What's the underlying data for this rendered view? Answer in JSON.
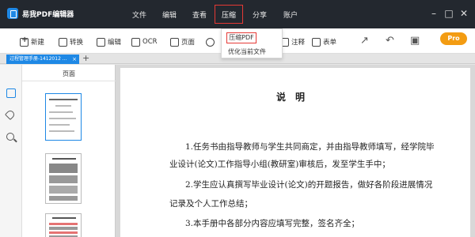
{
  "app": {
    "title": "易我PDF编辑器"
  },
  "menu": {
    "items": [
      "文件",
      "编辑",
      "查看",
      "压缩",
      "分享",
      "账户"
    ],
    "active": "压缩"
  },
  "toolbar": {
    "new_label": "新建",
    "convert_label": "转换",
    "edit_label": "编辑",
    "ocr_label": "OCR",
    "page_label": "页面",
    "annotate_label": "注释",
    "form_label": "表单",
    "pro_badge": "Pro"
  },
  "dropdown": {
    "items": [
      "压缩PDF",
      "优化当前文件"
    ]
  },
  "tabs": {
    "doc_tab": "过程管理手册-1412012 ...",
    "new_tab": "+"
  },
  "sidebar": {
    "title": "页面"
  },
  "document": {
    "heading": "说明",
    "lines": [
      "1.任务书由指导教师与学生共同商定，并由指导教师填写，经学院毕",
      "业设计(论文)工作指导小组(教研室)审核后，发至学生手中；",
      "2.学生应认真撰写毕业设计(论文)的开题报告，做好各阶段进展情况",
      "记录及个人工作总结；",
      "3.本手册中各部分内容应填写完整，签名齐全；"
    ]
  },
  "colors": {
    "accent": "#1e88e5",
    "highlight": "#e53935",
    "titlebar": "#23282f",
    "pro": "#f39c12"
  }
}
